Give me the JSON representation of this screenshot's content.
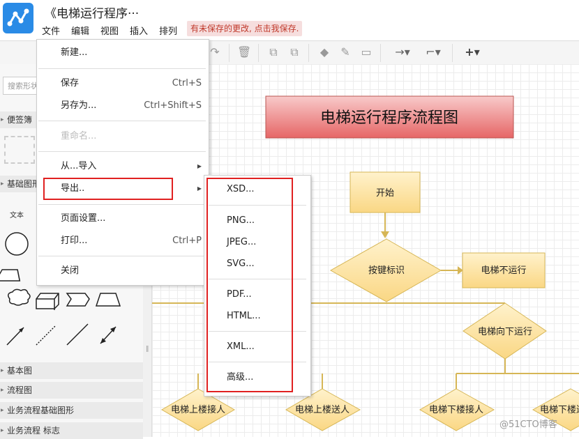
{
  "app": {
    "title": "《电梯运行程序···",
    "menus": [
      "文件",
      "编辑",
      "视图",
      "插入",
      "排列"
    ],
    "unsaved_notice": "有未保存的更改, 点击我保存."
  },
  "sidebar": {
    "search_placeholder": "搜索形状",
    "sections": [
      "便签簿",
      "基础图形",
      "基本图",
      "流程图",
      "业务流程基础图形",
      "业务流程 标志"
    ],
    "text_shape_label": "文本"
  },
  "file_menu": {
    "items": [
      {
        "label": "新建...",
        "shortcut": "",
        "disabled": false,
        "submenu": false
      },
      {
        "label": "保存",
        "shortcut": "Ctrl+S",
        "disabled": false,
        "submenu": false
      },
      {
        "label": "另存为...",
        "shortcut": "Ctrl+Shift+S",
        "disabled": false,
        "submenu": false
      },
      {
        "label": "重命名...",
        "shortcut": "",
        "disabled": true,
        "submenu": false
      },
      {
        "label": "从...导入",
        "shortcut": "",
        "disabled": false,
        "submenu": true
      },
      {
        "label": "导出..",
        "shortcut": "",
        "disabled": false,
        "submenu": true
      },
      {
        "label": "页面设置...",
        "shortcut": "",
        "disabled": false,
        "submenu": false
      },
      {
        "label": "打印...",
        "shortcut": "Ctrl+P",
        "disabled": false,
        "submenu": false
      },
      {
        "label": "关闭",
        "shortcut": "",
        "disabled": false,
        "submenu": false
      }
    ]
  },
  "export_menu": {
    "items": [
      "XSD...",
      "PNG...",
      "JPEG...",
      "SVG...",
      "PDF...",
      "HTML...",
      "XML...",
      "高级..."
    ]
  },
  "diagram": {
    "title": "电梯运行程序流程图",
    "nodes": {
      "start": "开始",
      "button_flag": "按键标识",
      "not_running": "电梯不运行",
      "down_running": "电梯向下运行",
      "up_pickup": "电梯上楼接人",
      "up_dropoff": "电梯上楼送人",
      "down_pickup": "电梯下楼接人",
      "down_dropoff": "电梯下楼送"
    }
  },
  "watermark": "@51CTO博客",
  "colors": {
    "accent": "#2a8be6",
    "highlight_red": "#e02020",
    "node_fill": "#fbe39a",
    "node_stroke": "#d6b656",
    "title_fill": "#f08080"
  }
}
